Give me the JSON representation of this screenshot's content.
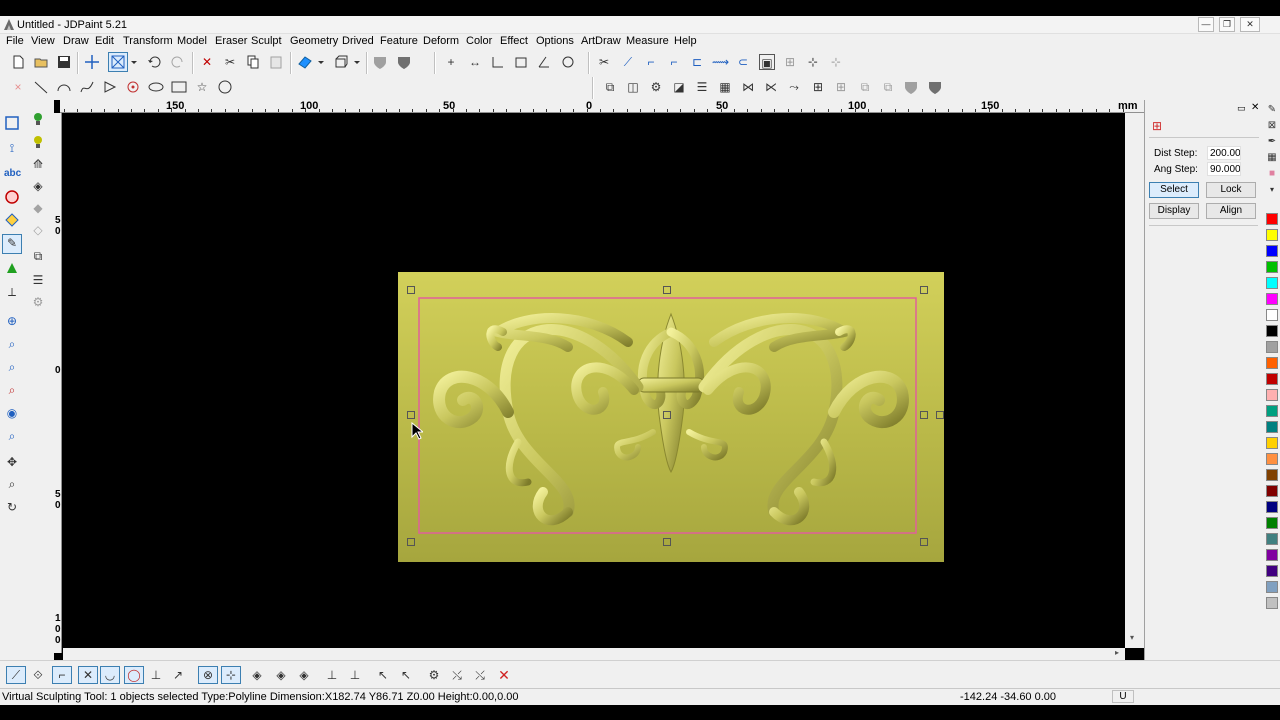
{
  "app": {
    "title": "Untitled - JDPaint 5.21",
    "window_buttons": [
      "minimize",
      "restore",
      "close"
    ]
  },
  "menu": [
    "File",
    "View",
    "Draw",
    "Edit",
    "Transform",
    "Model",
    "Eraser",
    "Sculpt",
    "Geometry",
    "Drived",
    "Feature",
    "Deform",
    "Color",
    "Effect",
    "Options",
    "ArtDraw",
    "Measure",
    "Help"
  ],
  "ruler": {
    "labels": [
      "150",
      "100",
      "50",
      "0",
      "50",
      "100",
      "150"
    ],
    "unit": "mm",
    "vertical_labels": [
      "5\n0",
      "0",
      "5\n0",
      "1\n0\n0"
    ]
  },
  "panel": {
    "dist_step_label": "Dist Step:",
    "dist_step_value": "200.000",
    "ang_step_label": "Ang Step:",
    "ang_step_value": "90.000",
    "select_label": "Select",
    "lock_label": "Lock",
    "display_label": "Display",
    "align_label": "Align"
  },
  "palette": [
    "#ff0000",
    "#ffff00",
    "#0000ff",
    "#00c000",
    "#00ffff",
    "#ff00ff",
    "#ffffff",
    "#000000",
    "#a0a0a0",
    "#ff6000",
    "#c00000",
    "#ffb0b0",
    "#00a080",
    "#008080",
    "#ffd000",
    "#ff9040",
    "#804000",
    "#800000",
    "#000080",
    "#008000",
    "#408080",
    "#8000a0",
    "#400080",
    "#80a0c0",
    "#c0c0c0"
  ],
  "status": {
    "text": "Virtual Sculpting Tool: 1 objects selected Type:Polyline Dimension:X182.74 Y86.71 Z0.00 Height:0.00,0.00",
    "coords": "-142.24 -34.60 0.00",
    "mode": "U"
  },
  "colors": {
    "model_base": "#b9b848",
    "selection_box": "#e0609a",
    "active_button": "#dcecfc"
  }
}
